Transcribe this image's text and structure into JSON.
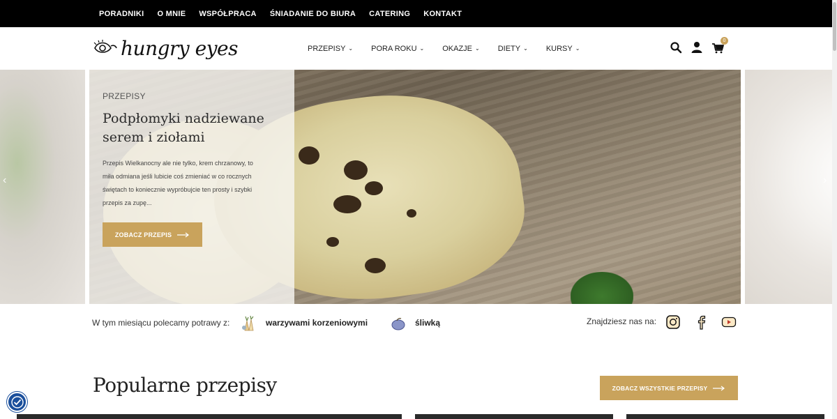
{
  "topbar": {
    "links": [
      "PORADNIKI",
      "O MNIE",
      "WSPÓŁPRACA",
      "ŚNIADANIE DO BIURA",
      "CATERING",
      "KONTAKT"
    ]
  },
  "header": {
    "logo_text": "hungry eyes",
    "nav": [
      "PRZEPISY",
      "PORA ROKU",
      "OKAZJE",
      "DIETY",
      "KURSY"
    ],
    "cart_count": "0",
    "icons": [
      "search-icon",
      "user-icon",
      "cart-icon"
    ]
  },
  "hero": {
    "label": "PRZEPISY",
    "title": "Podpłomyki nadziewane serem i ziołami",
    "description": "Przepis Wielkanocny ale nie tylko, krem chrzanowy, to miła odmiana jeśli lubicie coś zmieniać w co rocznych świętach to koniecznie wypróbujcie ten prosty i szybki przepis za zupę...",
    "button_label": "ZOBACZ PRZEPIS"
  },
  "season": {
    "lead": "W tym miesiącu polecamy potrawy z:",
    "item1": "warzywami korzeniowymi",
    "item2": "śliwką",
    "find_us": "Znajdziesz nas na:"
  },
  "popular": {
    "title": "Popularne przepisy",
    "all_button": "ZOBACZ WSZYSTKIE PRZEPISY"
  },
  "colors": {
    "accent": "#c9a35c",
    "topbar": "#000000",
    "accessibility": "#1a4f9c"
  }
}
